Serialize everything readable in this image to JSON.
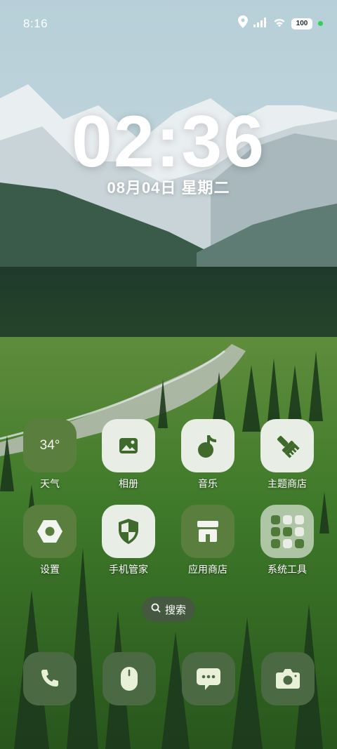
{
  "status_bar": {
    "time": "8:16",
    "battery": "100",
    "icons": [
      "location-icon",
      "signal-icon",
      "wifi-icon",
      "battery-icon"
    ]
  },
  "lockclock": {
    "time": "02:36",
    "date": "08月04日 星期二"
  },
  "apps": [
    {
      "label": "天气",
      "icon": "weather-icon",
      "temp": "34°"
    },
    {
      "label": "相册",
      "icon": "gallery-icon"
    },
    {
      "label": "音乐",
      "icon": "music-icon"
    },
    {
      "label": "主题商店",
      "icon": "theme-store-icon"
    },
    {
      "label": "设置",
      "icon": "settings-icon"
    },
    {
      "label": "手机管家",
      "icon": "security-icon"
    },
    {
      "label": "应用商店",
      "icon": "app-store-icon"
    },
    {
      "label": "系统工具",
      "icon": "system-tools-folder-icon"
    }
  ],
  "search": {
    "label": "搜索"
  },
  "dock": [
    {
      "name": "phone-icon"
    },
    {
      "name": "browser-icon"
    },
    {
      "name": "messages-icon"
    },
    {
      "name": "camera-icon"
    }
  ],
  "colors": {
    "accent_green": "#5a7e3e",
    "tile_light": "#e8ede6",
    "icon_dark_green": "#3f6a2b"
  }
}
